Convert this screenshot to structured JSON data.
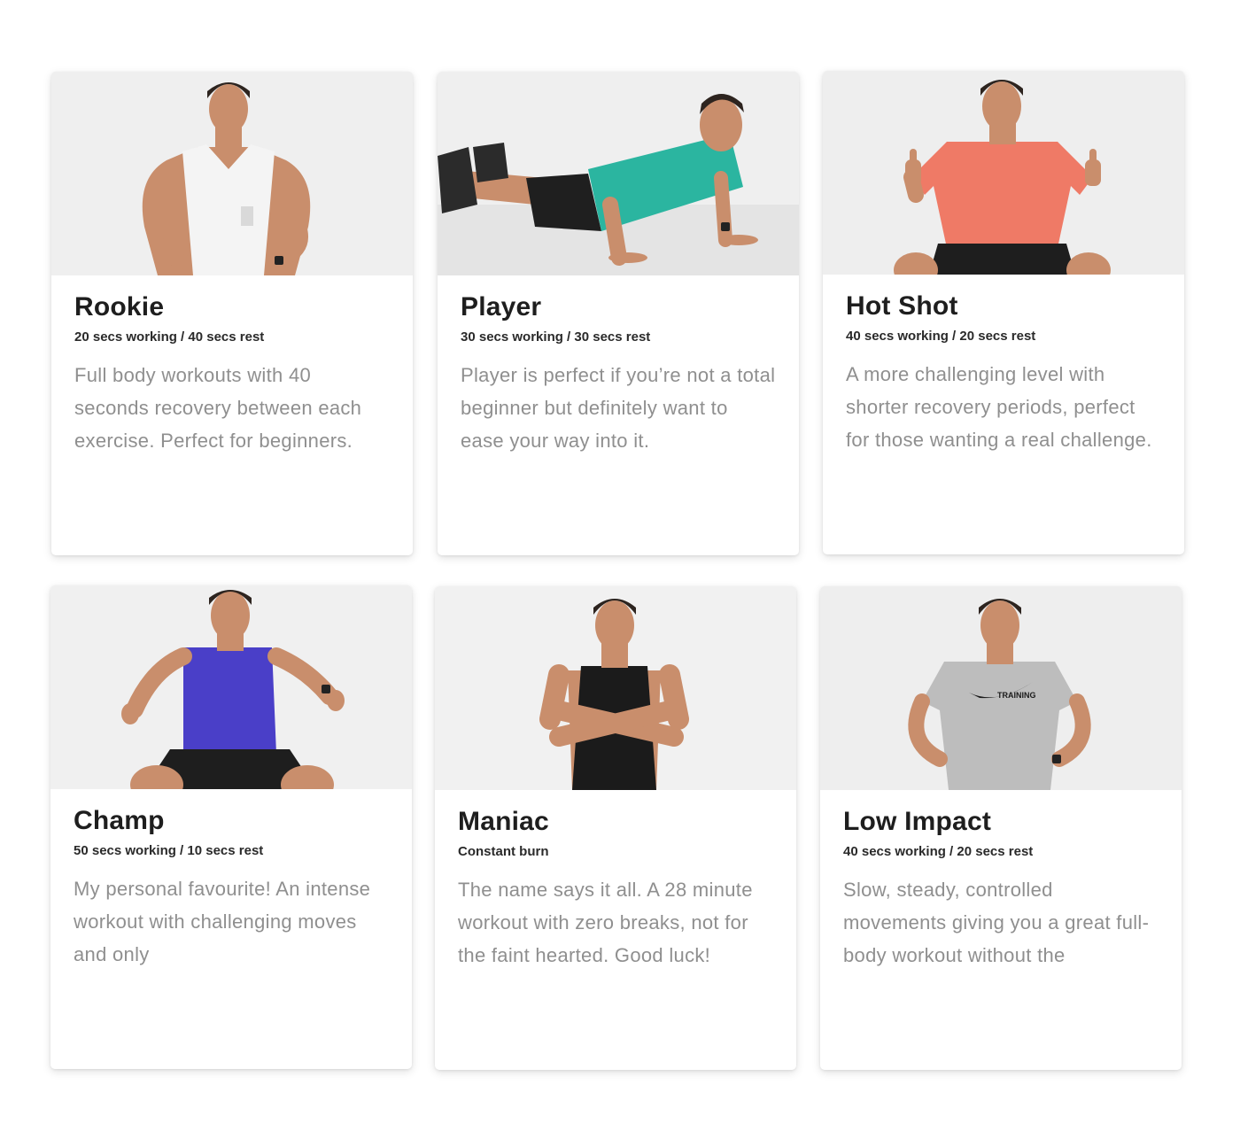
{
  "levels": [
    {
      "title": "Rookie",
      "subtitle": "20 secs working / 40 secs rest",
      "description": "Full body workouts with 40 seconds recovery between each exercise. Perfect for beginners.",
      "photo_icon": "trainer-hands-on-hips-white-tank-photo",
      "shirt_color": "#f4f4f4"
    },
    {
      "title": "Player",
      "subtitle": "30 secs working / 30 secs rest",
      "description": "Player is perfect if you’re not a total beginner but definitely want to ease your way into it.",
      "photo_icon": "trainer-push-up-teal-tank-photo",
      "shirt_color": "#2bb5a0"
    },
    {
      "title": "Hot Shot",
      "subtitle": "40 secs working / 20 secs rest",
      "description": "A more challenging level with shorter recovery periods, perfect for those wanting a real challenge.",
      "photo_icon": "trainer-thumbs-up-coral-shirt-photo",
      "shirt_color": "#ef7a66"
    },
    {
      "title": "Champ",
      "subtitle": "50 secs working / 10 secs rest",
      "description": "My personal favourite! An intense workout with challenging moves and only",
      "photo_icon": "trainer-squat-blue-tank-photo",
      "shirt_color": "#4a3fc8"
    },
    {
      "title": "Maniac",
      "subtitle": "Constant burn",
      "description": "The name says it all. A 28 minute workout with zero breaks, not for the faint hearted. Good luck!",
      "photo_icon": "trainer-arms-crossed-black-tank-photo",
      "shirt_color": "#1b1b1b"
    },
    {
      "title": "Low Impact",
      "subtitle": "40 secs working / 20 secs rest",
      "description": "Slow, steady, controlled movements giving you a great full-body workout without the",
      "photo_icon": "trainer-hands-on-hips-grey-tee-photo",
      "shirt_color": "#bdbdbd",
      "shirt_print": "TRAINING"
    }
  ]
}
